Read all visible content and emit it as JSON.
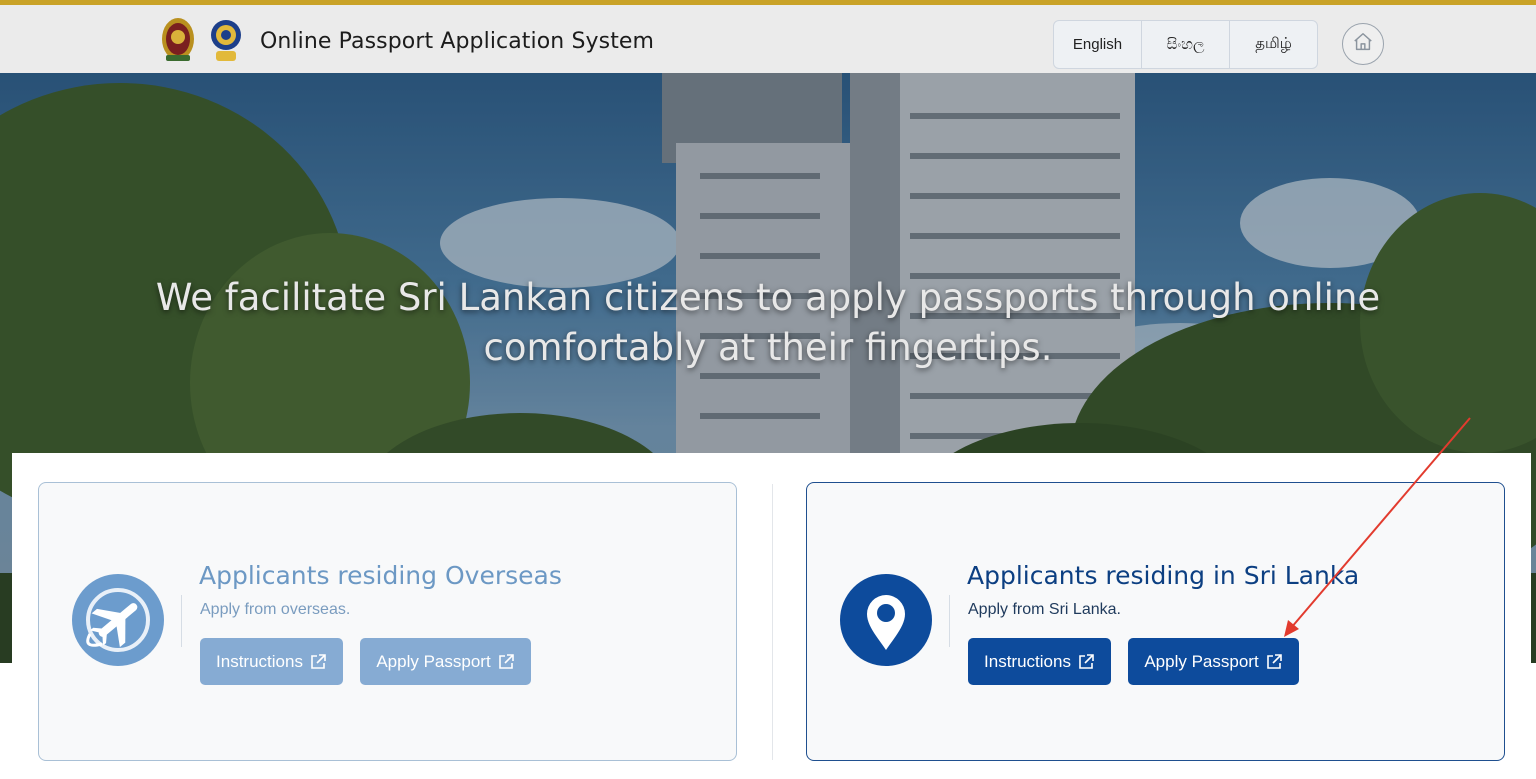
{
  "header": {
    "title": "Online Passport Application System",
    "languages": [
      "English",
      "සිංහල",
      "தமிழ்"
    ]
  },
  "hero": {
    "line1": "We facilitate Sri Lankan citizens to apply passports through online",
    "line2": "comfortably at their fingertips."
  },
  "cards": {
    "overseas": {
      "title": "Applicants residing Overseas",
      "subtitle": "Apply from overseas.",
      "instructions_label": "Instructions",
      "apply_label": "Apply Passport",
      "icon": "plane-globe-icon"
    },
    "local": {
      "title": "Applicants residing in Sri Lanka",
      "subtitle": "Apply from Sri Lanka.",
      "instructions_label": "Instructions",
      "apply_label": "Apply Passport",
      "icon": "location-pin-icon"
    }
  },
  "colors": {
    "accent_gold": "#c9a227",
    "primary_blue": "#0d4b9c",
    "muted_blue": "#86abd3",
    "annotation_red": "#e23b2e"
  }
}
